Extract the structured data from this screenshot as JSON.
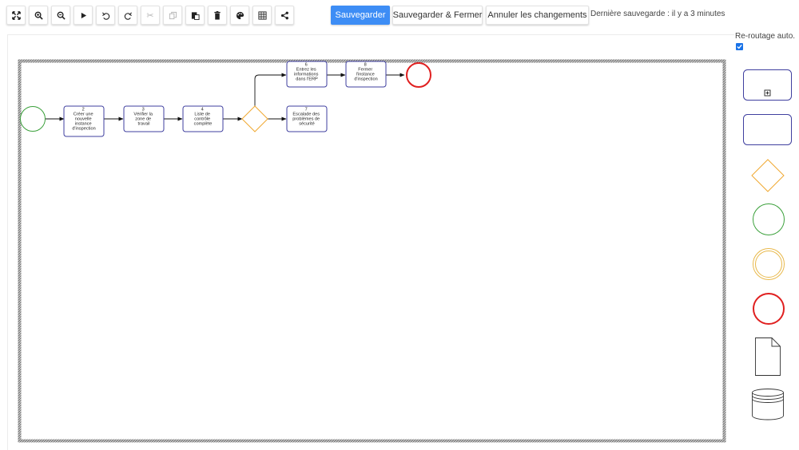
{
  "toolbar": {
    "icons": [
      {
        "name": "fit-to-screen-icon",
        "glyph": "⤧",
        "disabled": false
      },
      {
        "name": "zoom-in-icon",
        "glyph": "zoom-in",
        "disabled": false
      },
      {
        "name": "zoom-out-icon",
        "glyph": "zoom-out",
        "disabled": false
      },
      {
        "name": "play-icon",
        "glyph": "▶",
        "disabled": false
      },
      {
        "name": "undo-icon",
        "glyph": "↶",
        "disabled": false
      },
      {
        "name": "redo-icon",
        "glyph": "↷",
        "disabled": false
      },
      {
        "name": "cut-icon",
        "glyph": "✂",
        "disabled": true
      },
      {
        "name": "copy-icon",
        "glyph": "⎘",
        "disabled": true
      },
      {
        "name": "paste-icon",
        "glyph": "paste",
        "disabled": false
      },
      {
        "name": "delete-icon",
        "glyph": "trash",
        "disabled": false
      },
      {
        "name": "palette-icon",
        "glyph": "palette",
        "disabled": false
      },
      {
        "name": "grid-icon",
        "glyph": "grid",
        "disabled": false
      },
      {
        "name": "share-icon",
        "glyph": "share",
        "disabled": false
      }
    ],
    "save_label": "Sauvegarder",
    "save_close_label": "Sauvegarder & Fermer",
    "cancel_label": "Annuler les changements",
    "last_saved": "Dernière sauvegarde : il y a 3 minutes",
    "accent_color": "#3d8df5"
  },
  "options": {
    "reroute_label": "Re-routage auto.",
    "reroute_checked": true
  },
  "diagram": {
    "tasks": [
      {
        "id": "t2",
        "lines": [
          "2",
          "Créer une",
          "nouvelle",
          "instance",
          "d'inspection"
        ]
      },
      {
        "id": "t3",
        "lines": [
          "3",
          "Vérifier la",
          "zone de",
          "travail"
        ]
      },
      {
        "id": "t4",
        "lines": [
          "4",
          "Liste de",
          "contrôle",
          "complète"
        ]
      },
      {
        "id": "t6",
        "lines": [
          "6",
          "Entrez les",
          "informations",
          "dans l'ERP"
        ]
      },
      {
        "id": "t8",
        "lines": [
          "8",
          "Fermer",
          "l'instance",
          "d'inspection"
        ]
      },
      {
        "id": "t7",
        "lines": [
          "7",
          "Escalade des",
          "problèmes de",
          "sécurité"
        ]
      }
    ],
    "colors": {
      "task_border": "#3f3f9f",
      "start_event": "#3aa03a",
      "end_event": "#e02020",
      "gateway": "#f0a830",
      "intermediate_event": "#e8b84a",
      "pool_border": "#777777"
    }
  },
  "palette": {
    "items": [
      {
        "name": "subprocess-shape",
        "glyph": "⊞"
      },
      {
        "name": "task-shape"
      },
      {
        "name": "gateway-shape"
      },
      {
        "name": "start-event-shape"
      },
      {
        "name": "intermediate-event-shape"
      },
      {
        "name": "end-event-shape"
      },
      {
        "name": "data-object-shape"
      },
      {
        "name": "data-store-shape"
      }
    ]
  }
}
